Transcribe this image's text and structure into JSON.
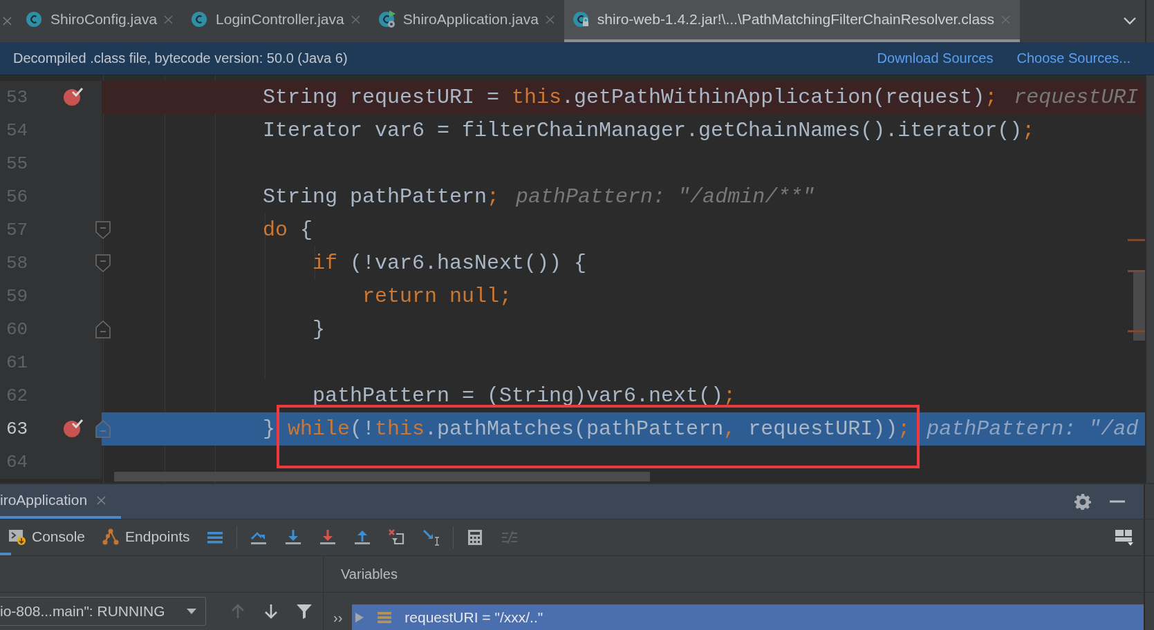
{
  "tabs": [
    {
      "label": "ShiroConfig.java",
      "kind": "class",
      "selected": false
    },
    {
      "label": "LoginController.java",
      "kind": "class",
      "selected": false
    },
    {
      "label": "ShiroApplication.java",
      "kind": "app",
      "selected": false
    },
    {
      "label": "shiro-web-1.4.2.jar!\\...\\PathMatchingFilterChainResolver.class",
      "kind": "library",
      "selected": true
    }
  ],
  "banner": {
    "message": "Decompiled .class file, bytecode version: 50.0 (Java 6)",
    "links": [
      "Download Sources",
      "Choose Sources..."
    ]
  },
  "editor": {
    "lines": [
      {
        "number": "53",
        "breakpoint": true,
        "current": false,
        "fold_start": false,
        "fold_end": false,
        "tokens": [
          {
            "kind": "text",
            "text": "String requestURI = "
          },
          {
            "kind": "keyword",
            "text": "this"
          },
          {
            "kind": "text",
            "text": ".getPathWithinApplication(request)"
          },
          {
            "kind": "keyword",
            "text": ";"
          },
          {
            "kind": "hint",
            "text": "requestURI"
          }
        ]
      },
      {
        "number": "54",
        "breakpoint": false,
        "current": false,
        "fold_start": false,
        "fold_end": false,
        "tokens": [
          {
            "kind": "text",
            "text": "Iterator var6 = filterChainManager.getChainNames().iterator()"
          },
          {
            "kind": "keyword",
            "text": ";"
          }
        ]
      },
      {
        "number": "55",
        "breakpoint": false,
        "current": false,
        "fold_start": false,
        "fold_end": false
      },
      {
        "number": "56",
        "breakpoint": false,
        "current": false,
        "fold_start": false,
        "fold_end": false,
        "tokens": [
          {
            "kind": "text",
            "text": "String pathPattern"
          },
          {
            "kind": "keyword",
            "text": ";"
          },
          {
            "kind": "hint",
            "text": "pathPattern: \"/admin/**\""
          }
        ]
      },
      {
        "number": "57",
        "breakpoint": false,
        "current": false,
        "fold_start": true,
        "fold_end": false,
        "tokens": [
          {
            "kind": "keyword",
            "text": "do"
          },
          {
            "kind": "text",
            "text": " {"
          }
        ],
        "children": [
          {
            "number": "58",
            "breakpoint": false,
            "current": false,
            "fold_start": true,
            "fold_end": false,
            "tokens": [
              {
                "kind": "keyword",
                "text": "if"
              },
              {
                "kind": "text",
                "text": " (!var6.hasNext()) {"
              }
            ],
            "children": [
              {
                "number": "59",
                "breakpoint": false,
                "current": false,
                "fold_start": false,
                "fold_end": false,
                "tokens": [
                  {
                    "kind": "keyword",
                    "text": "return null;"
                  }
                ]
              }
            ]
          },
          {
            "number": "60",
            "breakpoint": false,
            "current": false,
            "fold_start": false,
            "fold_end": true,
            "tokens": [
              {
                "kind": "text",
                "text": "}"
              }
            ]
          },
          {
            "number": "61",
            "breakpoint": false,
            "current": false,
            "fold_start": false,
            "fold_end": false
          },
          {
            "number": "62",
            "breakpoint": false,
            "current": false,
            "fold_start": false,
            "fold_end": false,
            "tokens": [
              {
                "kind": "text",
                "text": "pathPattern = (String)var6.next()"
              },
              {
                "kind": "keyword",
                "text": ";"
              }
            ]
          }
        ]
      },
      {
        "number": "63",
        "breakpoint": true,
        "current": true,
        "fold_start": false,
        "fold_end": true,
        "tokens": [
          {
            "kind": "text",
            "text": "} "
          },
          {
            "kind": "keyword",
            "text": "while"
          },
          {
            "kind": "text",
            "text": "(!"
          },
          {
            "kind": "keyword",
            "text": "this"
          },
          {
            "kind": "text",
            "text": ".pathMatches(pathPattern"
          },
          {
            "kind": "keyword",
            "text": ","
          },
          {
            "kind": "text",
            "text": " requestURI))"
          },
          {
            "kind": "keyword",
            "text": ";"
          },
          {
            "kind": "hint",
            "text": "pathPattern: \"/ad"
          }
        ]
      },
      {
        "number": "64",
        "breakpoint": false,
        "current": false,
        "fold_start": false,
        "fold_end": false
      }
    ]
  },
  "debug_panel": {
    "session_tab": {
      "label": "iroApplication",
      "selected": true
    },
    "tabs": [
      {
        "label": "Console",
        "kind": "console",
        "selected": false
      },
      {
        "label": "Endpoints",
        "kind": "endpoints",
        "selected": false
      }
    ],
    "toolbar": [
      {
        "kind": "menu",
        "disabled": false
      },
      {
        "kind": "step-over",
        "disabled": false
      },
      {
        "kind": "step-into",
        "disabled": false
      },
      {
        "kind": "force-step-into",
        "disabled": false
      },
      {
        "kind": "step-out",
        "disabled": false
      },
      {
        "kind": "drop-frame",
        "disabled": false
      },
      {
        "kind": "run-to-cursor",
        "disabled": false
      },
      {
        "kind": "evaluate",
        "disabled": false
      },
      {
        "kind": "trace",
        "disabled": true
      }
    ],
    "thread": "io-808...main\": RUNNING",
    "frame_buttons": [
      {
        "kind": "up",
        "disabled": true
      },
      {
        "kind": "down",
        "disabled": false
      },
      {
        "kind": "filter",
        "disabled": false
      }
    ],
    "more": "››",
    "variables": {
      "title": "Variables",
      "rows": [
        {
          "name": "requestURI = ",
          "value": "\"/xxx/..\"",
          "selected": true
        }
      ]
    }
  }
}
